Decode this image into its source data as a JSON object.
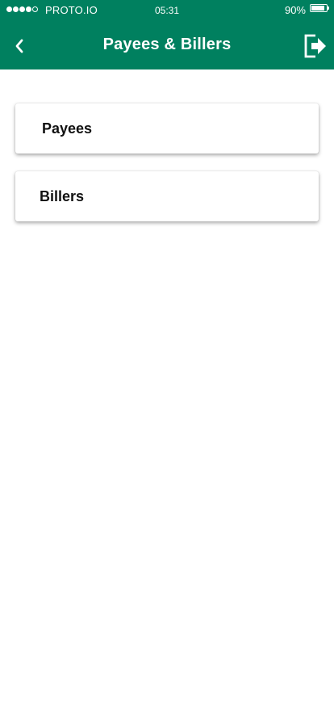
{
  "status_bar": {
    "carrier": "PROTO.IO",
    "time": "05:31",
    "battery_percent_text": "90%",
    "battery_level": 0.9,
    "signal_filled": 4,
    "signal_total": 5
  },
  "header": {
    "title": "Payees & Billers",
    "back_icon": "chevron-left-icon",
    "logout_icon": "logout-icon",
    "background_color": "#00805f"
  },
  "menu": {
    "items": [
      {
        "label": "Payees"
      },
      {
        "label": "Billers"
      }
    ]
  }
}
